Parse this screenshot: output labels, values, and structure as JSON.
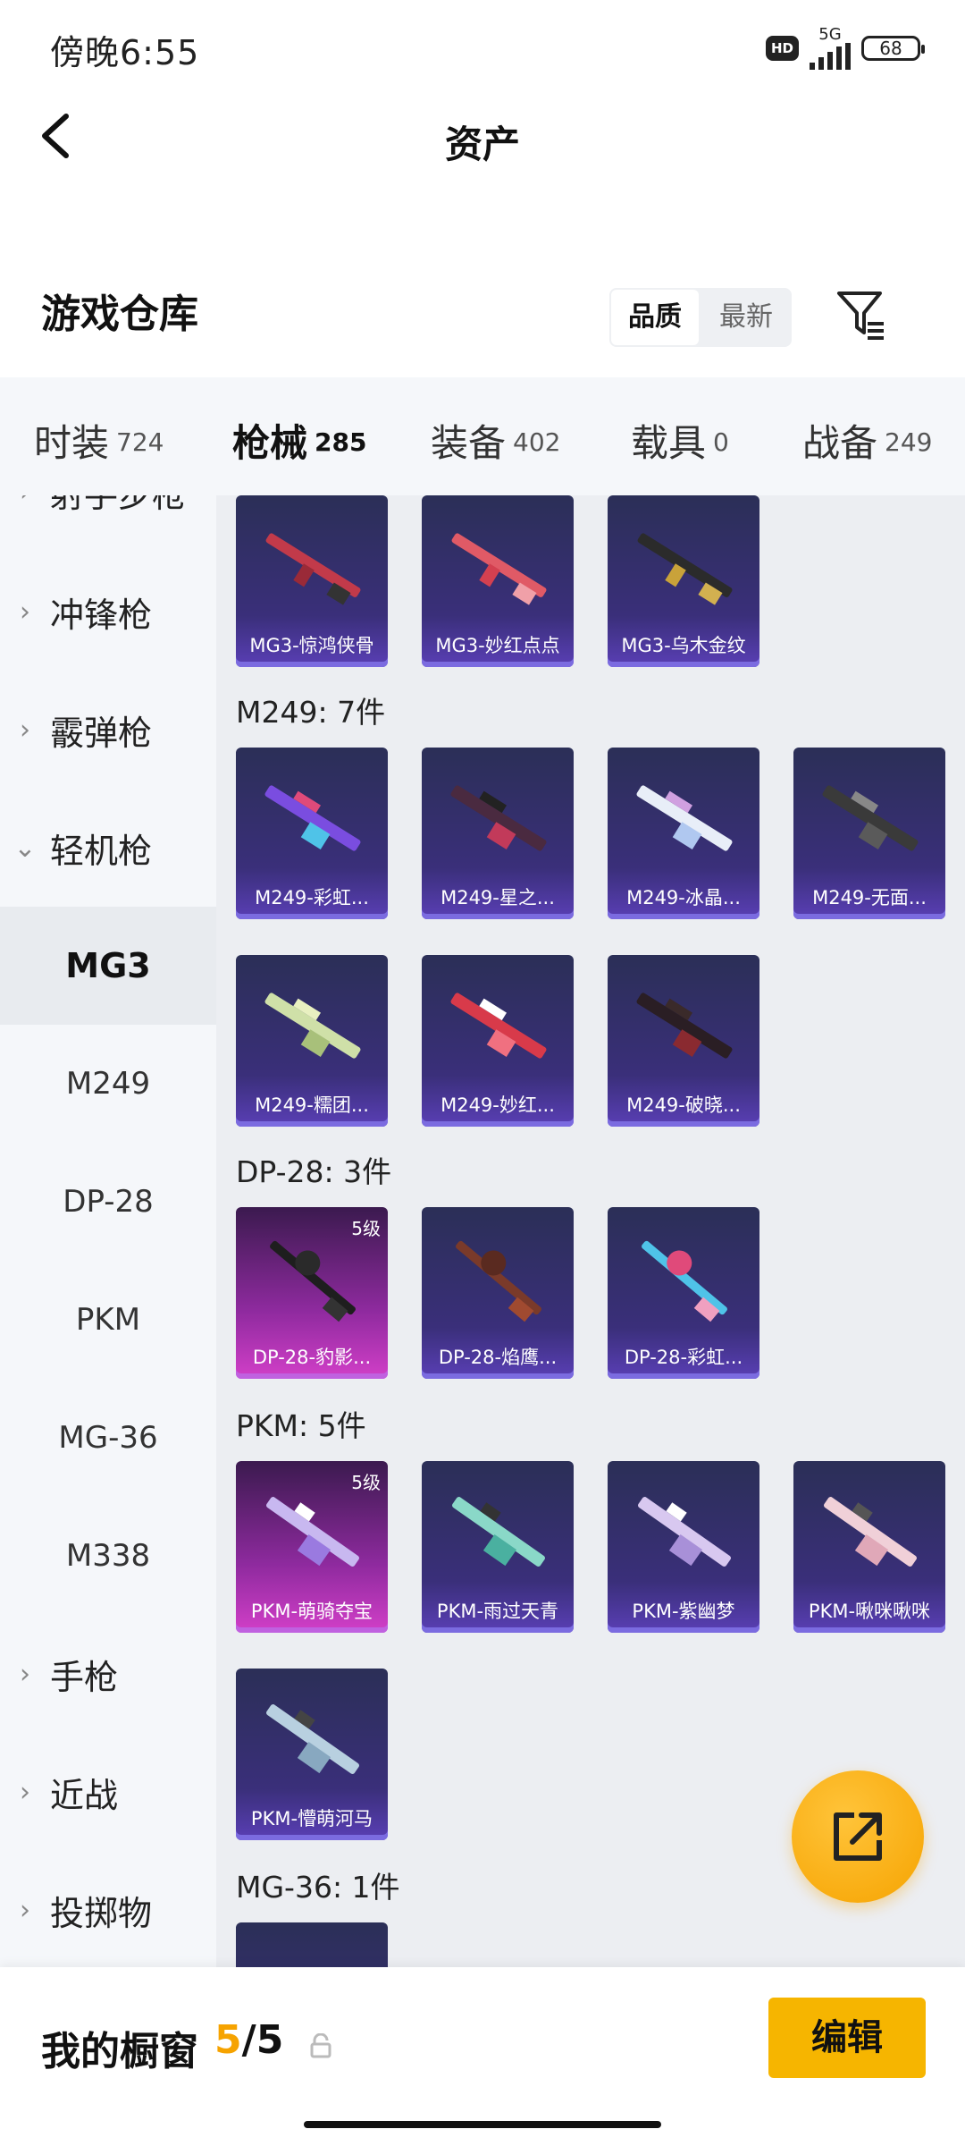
{
  "status": {
    "time": "傍晚6:55",
    "hd": "HD",
    "network": "5G",
    "battery": "68"
  },
  "nav": {
    "title": "资产"
  },
  "warehouse": {
    "title": "游戏仓库",
    "sort_options": [
      "品质",
      "最新"
    ],
    "sort_selected": "品质"
  },
  "tabs": [
    {
      "label": "时装",
      "count": "724"
    },
    {
      "label": "枪械",
      "count": "285",
      "active": true
    },
    {
      "label": "装备",
      "count": "402"
    },
    {
      "label": "载具",
      "count": "0"
    },
    {
      "label": "战备",
      "count": "249"
    }
  ],
  "sidebar": {
    "categories": [
      "射手步枪",
      "冲锋枪",
      "霰弹枪",
      "轻机枪",
      "手枪",
      "近战",
      "投掷物"
    ],
    "subcategories": [
      "MG3",
      "M249",
      "DP-28",
      "PKM",
      "MG-36",
      "M338"
    ],
    "selected": "MG3"
  },
  "groups": {
    "mg3": {
      "items": [
        "MG3-惊鸿侠骨",
        "MG3-妙红点点",
        "MG3-乌木金纹"
      ]
    },
    "m249": {
      "title": "M249: 7件",
      "items": [
        "M249-彩虹...",
        "M249-星之...",
        "M249-冰晶...",
        "M249-无面...",
        "M249-糯团...",
        "M249-妙红...",
        "M249-破晓..."
      ]
    },
    "dp28": {
      "title": "DP-28: 3件",
      "items": [
        "DP-28-豹影...",
        "DP-28-焰鹰...",
        "DP-28-彩虹..."
      ],
      "level_badge": "5级"
    },
    "pkm": {
      "title": "PKM: 5件",
      "items": [
        "PKM-萌骑夺宝",
        "PKM-雨过天青",
        "PKM-紫幽梦",
        "PKM-啾咪啾咪",
        "PKM-懵萌河马"
      ],
      "level_badge": "5级"
    },
    "mg36": {
      "title": "MG-36: 1件"
    }
  },
  "bottom": {
    "label": "我的橱窗",
    "count_current": "5",
    "count_total": "/5",
    "edit_label": "编辑"
  },
  "colors": {
    "accent": "#f6b500",
    "card_purple": "#3a2f7a",
    "card_gold": "#d23fc8"
  }
}
